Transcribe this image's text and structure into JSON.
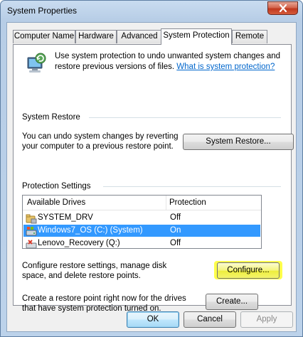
{
  "window": {
    "title": "System Properties"
  },
  "tabs": [
    {
      "label": "Computer Name"
    },
    {
      "label": "Hardware"
    },
    {
      "label": "Advanced"
    },
    {
      "label": "System Protection"
    },
    {
      "label": "Remote"
    }
  ],
  "intro": {
    "text": "Use system protection to undo unwanted system changes and restore previous versions of files. ",
    "link": "What is system protection?"
  },
  "system_restore": {
    "title": "System Restore",
    "description": "You can undo system changes by reverting your computer to a previous restore point.",
    "button": "System Restore..."
  },
  "protection_settings": {
    "title": "Protection Settings",
    "columns": {
      "drives": "Available Drives",
      "protection": "Protection"
    },
    "drives": [
      {
        "name": "SYSTEM_DRV",
        "protection": "Off",
        "icon": "folder-drive-icon",
        "selected": false
      },
      {
        "name": "Windows7_OS (C:) (System)",
        "protection": "On",
        "icon": "system-drive-icon",
        "selected": true
      },
      {
        "name": "Lenovo_Recovery (Q:)",
        "protection": "Off",
        "icon": "recovery-drive-icon",
        "selected": false
      }
    ],
    "configure_text": "Configure restore settings, manage disk space, and delete restore points.",
    "configure_button": "Configure...",
    "create_text": "Create a restore point right now for the drives that have system protection turned on.",
    "create_button": "Create..."
  },
  "footer": {
    "ok": "OK",
    "cancel": "Cancel",
    "apply": "Apply"
  },
  "colors": {
    "selection": "#3399ff",
    "highlight": "#ffff4a",
    "link": "#0066cc"
  }
}
